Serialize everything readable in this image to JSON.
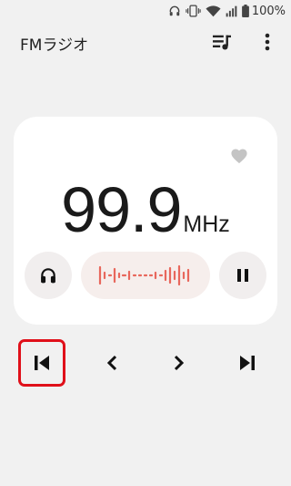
{
  "status_bar": {
    "battery_text": "100%",
    "icons": [
      "headphone-icon",
      "vibrate-icon",
      "wifi-icon",
      "signal-icon",
      "battery-icon"
    ]
  },
  "app_bar": {
    "title": "FMラジオ",
    "actions": [
      "station-list-icon",
      "more-vert-icon"
    ]
  },
  "player": {
    "frequency": "99.9",
    "unit": "MHz",
    "favorite_icon": "heart-icon",
    "left_button_icon": "headphone-icon",
    "right_button_icon": "pause-icon",
    "waveform_icon": "waveform-icon",
    "waveform_color": "#e8675c"
  },
  "navigation": {
    "buttons": [
      "skip-previous-icon",
      "chevron-left-icon",
      "chevron-right-icon",
      "skip-next-icon"
    ],
    "selected": "skip-previous-icon",
    "selected_outline_color": "#e0101a"
  }
}
